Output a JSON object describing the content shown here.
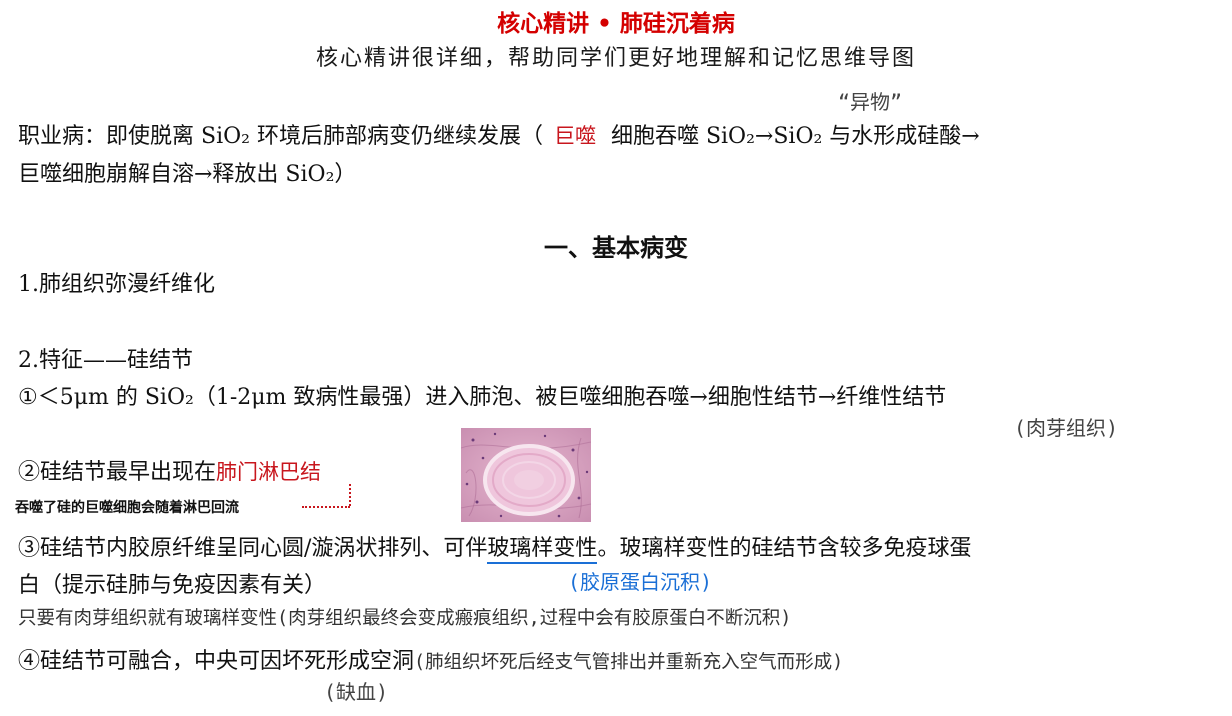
{
  "header": {
    "title": "核心精讲 • 肺硅沉着病",
    "subtitle": "核心精讲很详细，帮助同学们更好地理解和记忆思维导图"
  },
  "annotations": {
    "foreign_body": "“异物”",
    "macrophage_red": "巨噬",
    "granulation": "(肉芽组织)",
    "hilar_node": "肺门淋巴结",
    "lymph_note": "吞噬了硅的巨噬细胞会随着淋巴回流",
    "collagen_deposit": "(胶原蛋白沉积)",
    "granulation_note": "只要有肉芽组织就有玻璃样变性(肉芽组织最终会变成瘢痕组织,过程中会有胶原蛋白不断沉积)",
    "cavity_note": "(肺组织坏死后经支气管排出并重新充入空气而形成)",
    "ischemia": "(缺血)"
  },
  "intro": {
    "line1_a": "职业病：即使脱离 SiO₂ 环境后肺部病变仍继续发展（",
    "line1_b": "细胞吞噬 SiO₂→SiO₂ 与水形成硅酸→",
    "line2": "巨噬细胞崩解自溶→释放出 SiO₂）"
  },
  "section": {
    "heading": "一、基本病变",
    "item1": "1.肺组织弥漫纤维化",
    "item2": "2.特征——硅结节",
    "point1": "①＜5μm 的 SiO₂（1-2μm 致病性最强）进入肺泡、被巨噬细胞吞噬→细胞性结节→纤维性结节",
    "point2": "②硅结节最早出现在",
    "point3_a": "③硅结节内胶原纤维呈同心圆/漩涡状排列、可伴",
    "point3_underlined": "玻璃样变性",
    "point3_b": "。玻璃样变性的硅结节含较多免疫球蛋",
    "point3_line2": "白（提示硅肺与免疫因素有关）",
    "point4": "④硅结节可融合，中央可因坏死形成空洞"
  },
  "colors": {
    "title_red": "#d40000",
    "hand_red": "#c8161d",
    "hand_blue": "#1a6fd6"
  }
}
